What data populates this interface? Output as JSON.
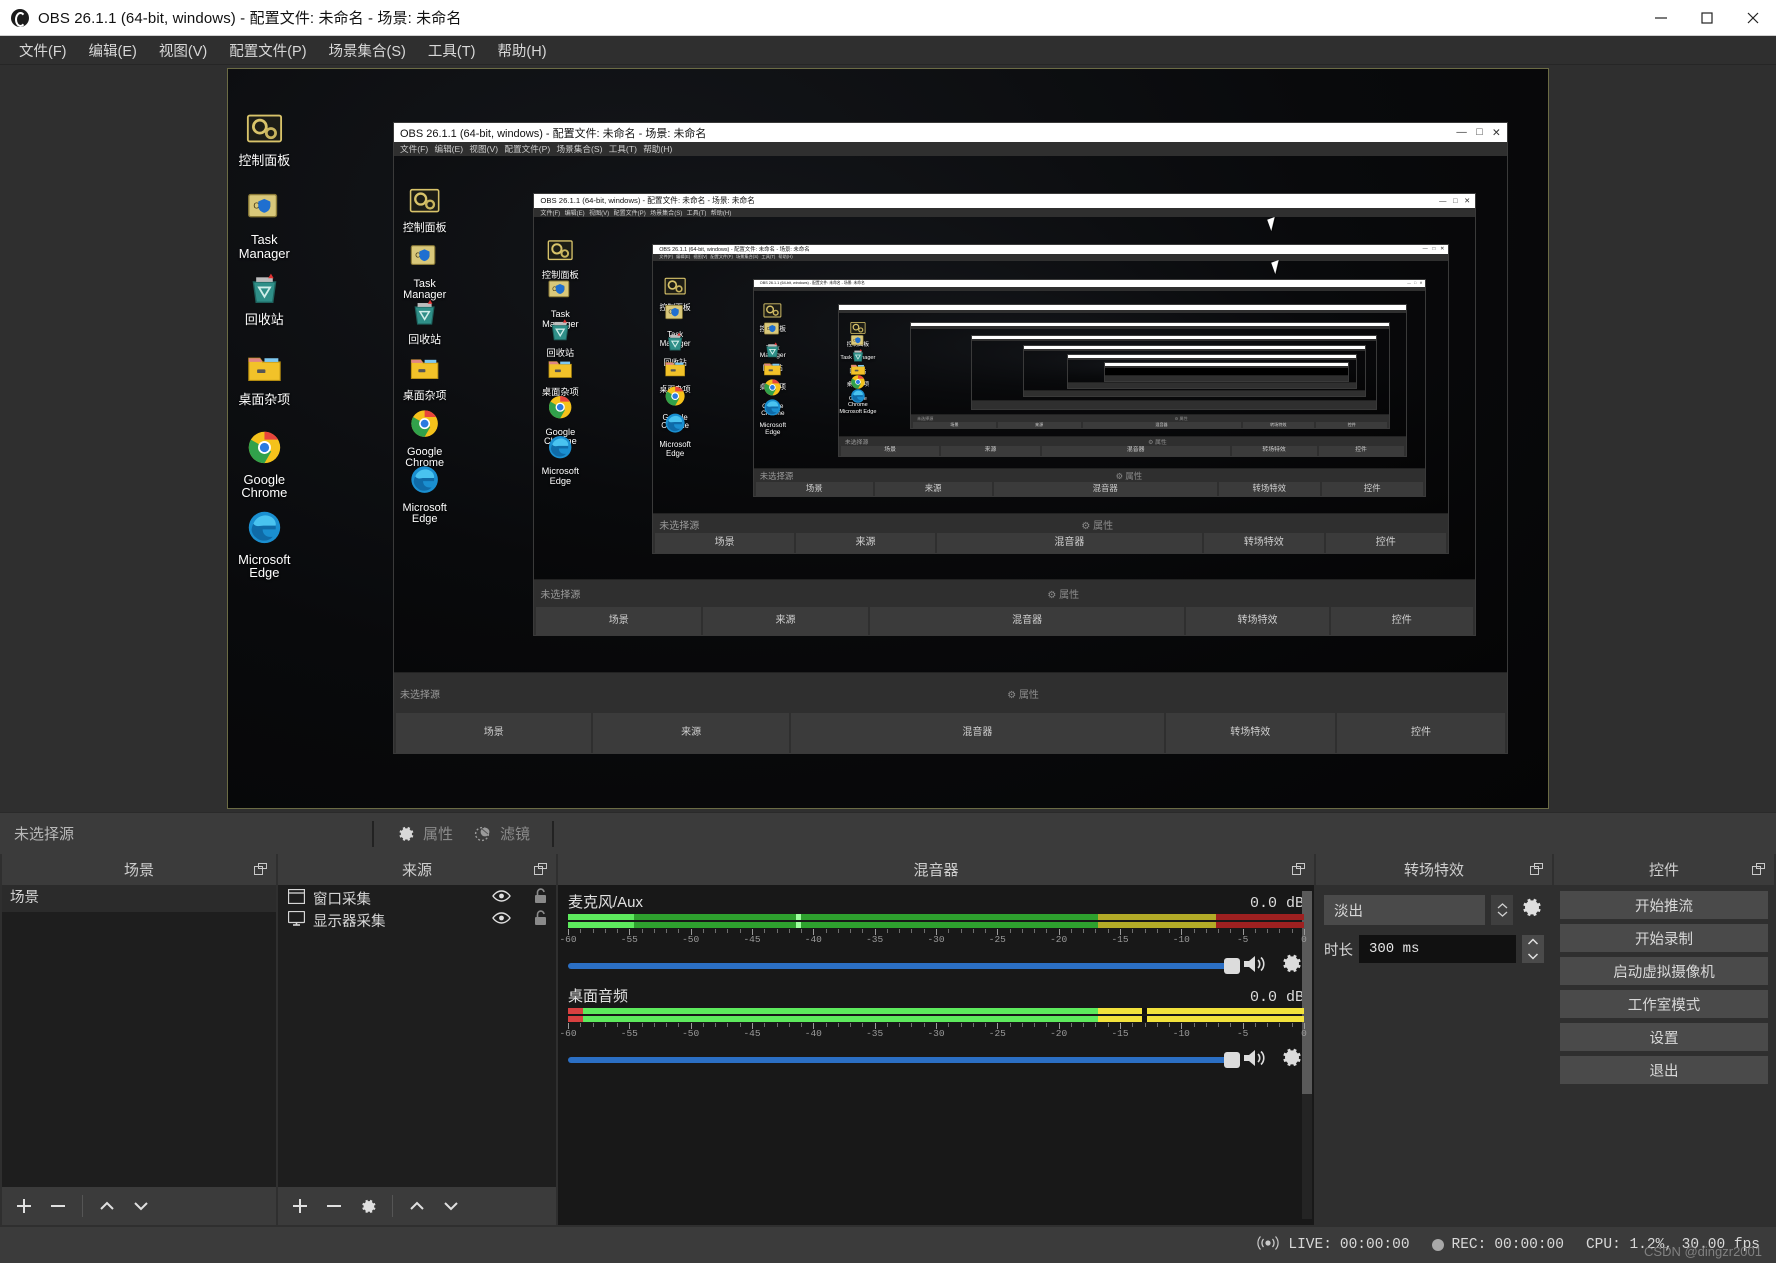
{
  "window": {
    "title": "OBS 26.1.1 (64-bit, windows) - 配置文件: 未命名 - 场景: 未命名",
    "minimize_label": "最小化",
    "maximize_label": "最大化",
    "close_label": "关闭"
  },
  "menubar": {
    "items": [
      {
        "label": "文件(F)"
      },
      {
        "label": "编辑(E)"
      },
      {
        "label": "视图(V)"
      },
      {
        "label": "配置文件(P)"
      },
      {
        "label": "场景集合(S)"
      },
      {
        "label": "工具(T)"
      },
      {
        "label": "帮助(H)"
      }
    ]
  },
  "preview": {
    "recursion_depth": 13,
    "desktop_icons": [
      {
        "label": "控制面板",
        "icon": "control-panel-icon"
      },
      {
        "label": "Task Manager",
        "icon": "task-manager-icon"
      },
      {
        "label": "回收站",
        "icon": "recycle-bin-icon"
      },
      {
        "label": "桌面杂项",
        "icon": "folder-icon"
      },
      {
        "label": "Google Chrome",
        "icon": "chrome-icon"
      },
      {
        "label": "Microsoft Edge",
        "icon": "edge-icon"
      }
    ],
    "nested_window_title": "OBS 26.1.1 (64-bit, windows) - 配置文件: 未命名 - 场景: 未命名",
    "nested_menu": [
      "文件(F)",
      "编辑(E)",
      "视图(V)",
      "配置文件(P)",
      "场景集合(S)",
      "工具(T)",
      "帮助(H)"
    ],
    "nested_docks": [
      "场景",
      "来源",
      "混音器",
      "转场特效",
      "控件"
    ],
    "nested_source_status": "未选择源"
  },
  "source_toolbar": {
    "status": "未选择源",
    "properties_label": "属性",
    "filters_label": "滤镜"
  },
  "scenes": {
    "title": "场景",
    "items": [
      {
        "label": "场景"
      }
    ],
    "footer": {
      "add_label": "添加场景",
      "remove_label": "移除场景",
      "up_label": "上移",
      "down_label": "下移"
    }
  },
  "sources": {
    "title": "来源",
    "items": [
      {
        "label": "窗口采集",
        "icon": "window-capture-icon",
        "visible": true,
        "locked": false
      },
      {
        "label": "显示器采集",
        "icon": "display-capture-icon",
        "visible": true,
        "locked": false
      }
    ],
    "footer": {
      "add_label": "添加来源",
      "remove_label": "移除来源",
      "properties_label": "属性",
      "up_label": "上移",
      "down_label": "下移"
    }
  },
  "mixer": {
    "title": "混音器",
    "tick_labels": [
      "-60",
      "-55",
      "-50",
      "-45",
      "-40",
      "-35",
      "-30",
      "-25",
      "-20",
      "-15",
      "-10",
      "-5",
      "0"
    ],
    "channels": [
      {
        "name": "麦克风/Aux",
        "db": "0.0 dB",
        "level_pct": 72,
        "peak_pct": 31,
        "volume_pct": 100,
        "muted": false
      },
      {
        "name": "桌面音频",
        "db": "0.0 dB",
        "level_pct": 72,
        "peak_pct": 78,
        "volume_pct": 100,
        "muted": false
      }
    ]
  },
  "transitions": {
    "title": "转场特效",
    "selected": "淡出",
    "duration_label": "时长",
    "duration_value": "300 ms",
    "gear_label": "转场属性"
  },
  "controls": {
    "title": "控件",
    "buttons": [
      {
        "label": "开始推流"
      },
      {
        "label": "开始录制"
      },
      {
        "label": "启动虚拟摄像机"
      },
      {
        "label": "工作室模式"
      },
      {
        "label": "设置"
      },
      {
        "label": "退出"
      }
    ]
  },
  "statusbar": {
    "live_label": "LIVE:",
    "live_time": "00:00:00",
    "rec_label": "REC:",
    "rec_time": "00:00:00",
    "cpu": "CPU: 1.2%, 30.00 fps",
    "watermark": "CSDN @dingzr2001"
  },
  "colors": {
    "accent_blue": "#2b6fc4",
    "meter_green": "#2ea12e",
    "meter_green_light": "#5dea5d",
    "meter_yellow": "#b3ab27",
    "meter_yellow_bright": "#f2e23c",
    "meter_red": "#9e2020",
    "panel": "#2f2f2f",
    "panel_dark": "#1e1e1e",
    "header": "#3b3b3b"
  }
}
